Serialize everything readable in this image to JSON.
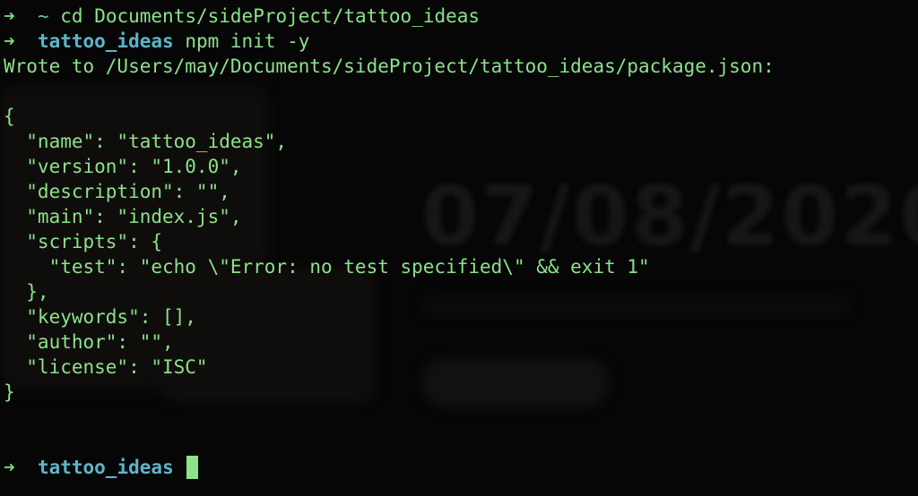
{
  "terminal": {
    "prompt_arrow": "➜",
    "line1": {
      "dir": "~",
      "command": "cd Documents/sideProject/tattoo_ideas"
    },
    "line2": {
      "dir": "tattoo_ideas",
      "command": "npm init -y"
    },
    "output": [
      "Wrote to /Users/may/Documents/sideProject/tattoo_ideas/package.json:",
      "",
      "{",
      "  \"name\": \"tattoo_ideas\",",
      "  \"version\": \"1.0.0\",",
      "  \"description\": \"\",",
      "  \"main\": \"index.js\",",
      "  \"scripts\": {",
      "    \"test\": \"echo \\\"Error: no test specified\\\" && exit 1\"",
      "  },",
      "  \"keywords\": [],",
      "  \"author\": \"\",",
      "  \"license\": \"ISC\"",
      "}",
      "",
      ""
    ],
    "current_prompt": {
      "dir": "tattoo_ideas",
      "input": ""
    }
  },
  "background": {
    "date_text": "07/08/2020"
  },
  "colors": {
    "background": "#060606",
    "text": "#8be28a",
    "directory": "#5fb4c8",
    "cursor": "#8be28a"
  }
}
